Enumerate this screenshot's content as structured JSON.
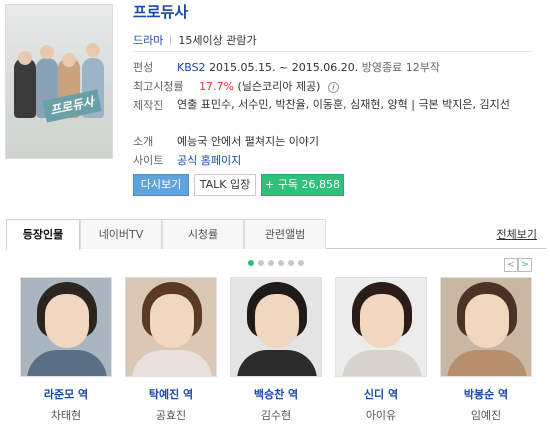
{
  "header": {
    "title": "프로듀사",
    "genre": "드라마",
    "rating": "15세이상 관람가"
  },
  "poster": {
    "title_text": "프로듀사"
  },
  "info": {
    "broadcast_label": "편성",
    "channel": "KBS2",
    "period": "2015.05.15. ~ 2015.06.20.",
    "status": "방영종료 12부작",
    "ratings_label": "최고시청률",
    "ratings_value": "17.7%",
    "ratings_source": "(닐슨코리아 제공)",
    "staff_label": "제작진",
    "staff_value": "연출 표민수, 서수민, 박찬율, 이동훈, 심재현, 양혁 | 극본 박지은, 김지선",
    "intro_label": "소개",
    "intro_value": "예능국 안에서 펼쳐지는 이야기",
    "site_label": "사이트",
    "site_value": "공식 홈페이지"
  },
  "buttons": {
    "watch": "다시보기",
    "talk": "TALK 입장",
    "subscribe": "+ 구독 26,858"
  },
  "tabs": [
    {
      "label": "등장인물"
    },
    {
      "label": "네이버TV"
    },
    {
      "label": "시청률"
    },
    {
      "label": "관련앨범"
    }
  ],
  "more_label": "전체보기",
  "cast": [
    {
      "role": "라준모 역",
      "actor": "차태현"
    },
    {
      "role": "탁예진 역",
      "actor": "공효진"
    },
    {
      "role": "백승찬 역",
      "actor": "김수현"
    },
    {
      "role": "신디 역",
      "actor": "아이유"
    },
    {
      "role": "박봉순 역",
      "actor": "임예진"
    }
  ],
  "colors": {
    "link_blue": "#1a49a8",
    "accent_green": "#2fc17b",
    "rating_red": "#e0392d",
    "watch_button": "#5fa3dd"
  }
}
